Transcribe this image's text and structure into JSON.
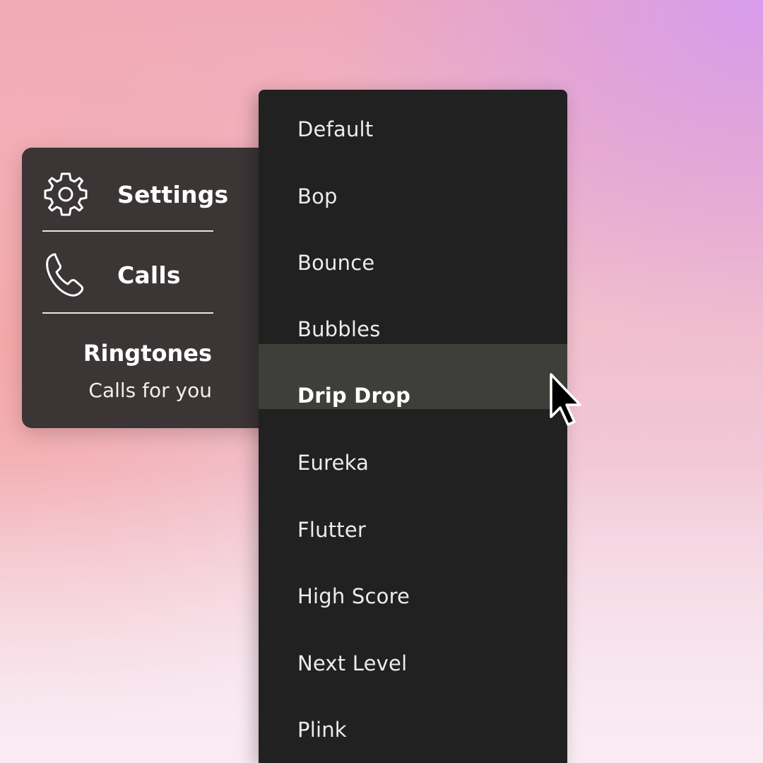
{
  "settings_panel": {
    "settings_label": "Settings",
    "settings_icon": "gear-icon",
    "calls_label": "Calls",
    "calls_icon": "phone-icon",
    "section_title": "Ringtones",
    "section_subtitle": "Calls for you"
  },
  "ringtone_list": {
    "options": [
      "Default",
      "Bop",
      "Bounce",
      "Bubbles",
      "Drip Drop",
      "Eureka",
      "Flutter",
      "High Score",
      "Next Level",
      "Plink"
    ],
    "hovered": "Drip Drop"
  },
  "colors": {
    "panel_bg": "#3b3536",
    "dropdown_bg": "#212121",
    "hover_bg": "#3e3e3b",
    "text": "#ffffff"
  }
}
